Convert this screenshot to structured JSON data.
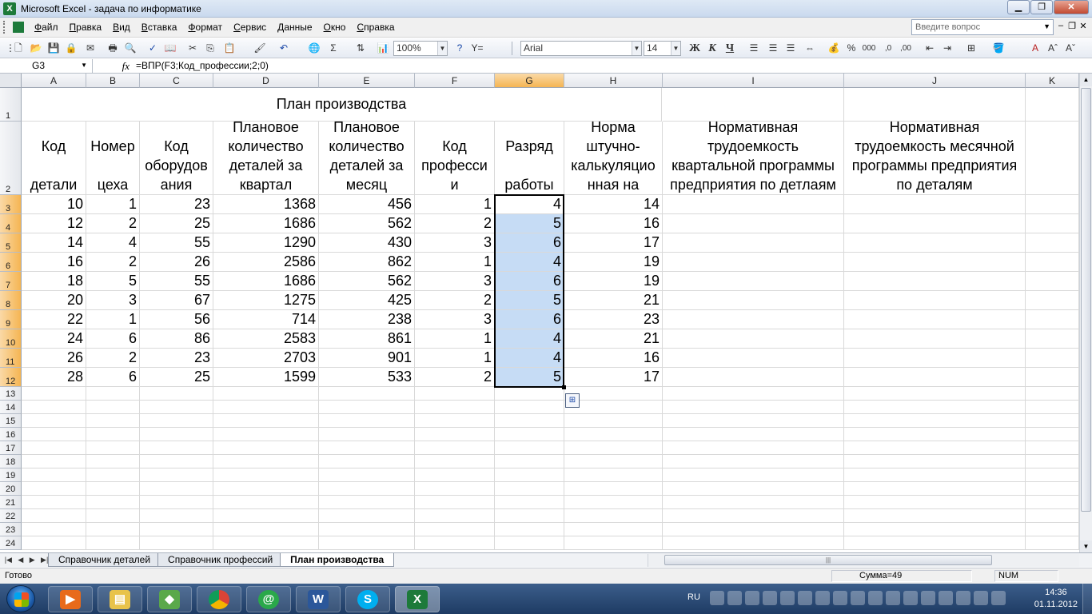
{
  "window": {
    "title": "Microsoft Excel - задача по информатике",
    "app_glyph": "X"
  },
  "menu": {
    "items": [
      "Файл",
      "Правка",
      "Вид",
      "Вставка",
      "Формат",
      "Сервис",
      "Данные",
      "Окно",
      "Справка"
    ],
    "ask_placeholder": "Введите вопрос"
  },
  "toolbar": {
    "zoom": "100%",
    "font_name": "Arial",
    "font_size": "14",
    "bold": "Ж",
    "italic": "К",
    "underline": "Ч",
    "sum": "Σ",
    "percent": "%",
    "thousands": "000"
  },
  "formula_bar": {
    "name_box": "G3",
    "fx": "fx",
    "formula": "=ВПР(F3;Код_профессии;2;0)"
  },
  "columns": [
    "A",
    "B",
    "C",
    "D",
    "E",
    "F",
    "G",
    "H",
    "I",
    "J",
    "K"
  ],
  "rows": [
    "1",
    "2",
    "3",
    "4",
    "5",
    "6",
    "7",
    "8",
    "9",
    "10",
    "11",
    "12",
    "13",
    "14",
    "15",
    "16",
    "17",
    "18",
    "19",
    "20",
    "21",
    "22",
    "23",
    "24"
  ],
  "sheet": {
    "title": "План производства",
    "headers": [
      [
        "Код",
        "",
        "детали"
      ],
      [
        "Номер",
        "",
        "цеха"
      ],
      [
        "Код",
        "оборудов",
        "ания"
      ],
      [
        "Плановое",
        "количество",
        "деталей за",
        "квартал"
      ],
      [
        "Плановое",
        "количество",
        "деталей за",
        "месяц"
      ],
      [
        "Код",
        "професси",
        "и"
      ],
      [
        "Разряд",
        "",
        "работы"
      ],
      [
        "Норма",
        "штучно-",
        "калькуляцио",
        "нная на"
      ],
      [
        "Нормативная",
        "трудоемкость",
        "квартальной программы",
        "предприятия по детлаям"
      ],
      [
        "Нормативная",
        "трудоемкость месячной",
        "программы предприятия",
        "по деталям"
      ]
    ],
    "data": [
      [
        "10",
        "1",
        "23",
        "1368",
        "456",
        "1",
        "4",
        "14"
      ],
      [
        "12",
        "2",
        "25",
        "1686",
        "562",
        "2",
        "5",
        "16"
      ],
      [
        "14",
        "4",
        "55",
        "1290",
        "430",
        "3",
        "6",
        "17"
      ],
      [
        "16",
        "2",
        "26",
        "2586",
        "862",
        "1",
        "4",
        "19"
      ],
      [
        "18",
        "5",
        "55",
        "1686",
        "562",
        "3",
        "6",
        "19"
      ],
      [
        "20",
        "3",
        "67",
        "1275",
        "425",
        "2",
        "5",
        "21"
      ],
      [
        "22",
        "1",
        "56",
        "714",
        "238",
        "3",
        "6",
        "23"
      ],
      [
        "24",
        "6",
        "86",
        "2583",
        "861",
        "1",
        "4",
        "21"
      ],
      [
        "26",
        "2",
        "23",
        "2703",
        "901",
        "1",
        "4",
        "16"
      ],
      [
        "28",
        "6",
        "25",
        "1599",
        "533",
        "2",
        "5",
        "17"
      ]
    ]
  },
  "tabs": [
    "Справочник деталей",
    "Справочник профессий",
    "План производства"
  ],
  "active_tab": "План производства",
  "status": {
    "ready": "Готово",
    "sum": "Сумма=49",
    "num": "NUM"
  },
  "taskbar": {
    "lang": "RU",
    "time": "14:36",
    "date": "01.11.2012",
    "apps": [
      "media-player",
      "file-explorer",
      "desktop-app",
      "chrome",
      "mail-agent",
      "word",
      "skype",
      "excel"
    ]
  },
  "colors": {
    "selection": "#c6dcf5",
    "header_selected": "#f5b553",
    "title_bar": "#c9d9ee"
  }
}
